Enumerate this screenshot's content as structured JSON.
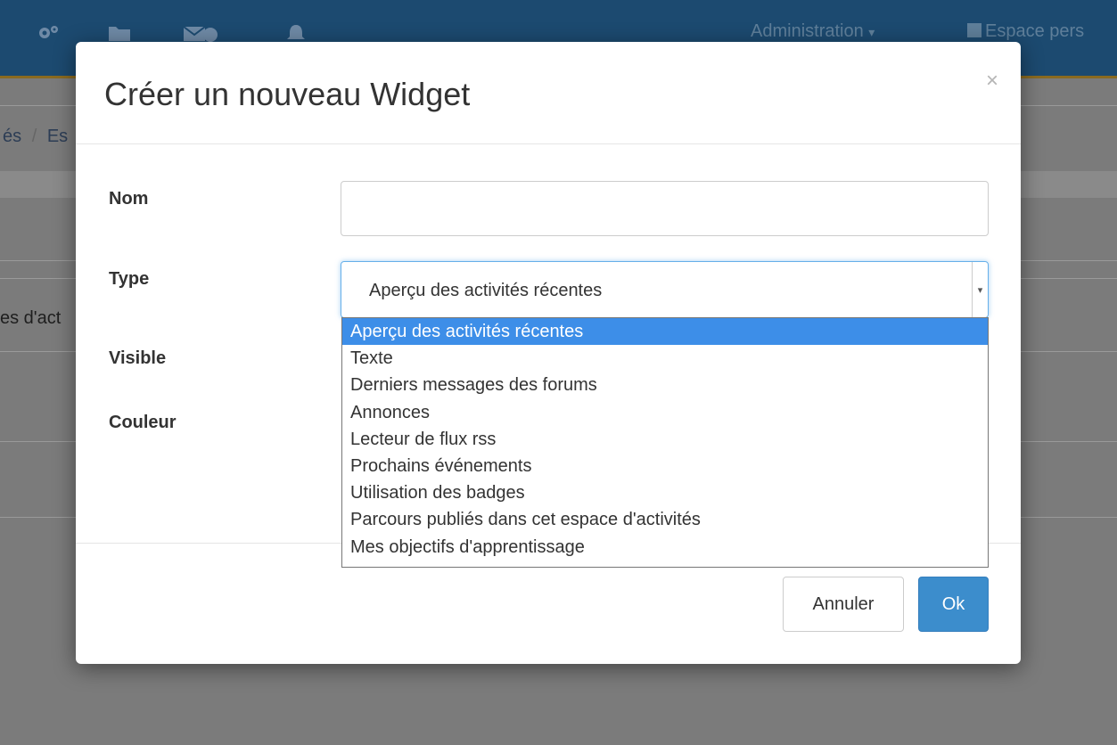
{
  "topbar": {
    "icons": [
      "cogs-icon",
      "folder-icon",
      "envelope-icon",
      "bell-icon"
    ],
    "admin_label": "Administration",
    "admin_caret": "▾",
    "personal_label": "Espace pers"
  },
  "background": {
    "breadcrumb_left": "és",
    "breadcrumb_sep": "/",
    "breadcrumb_right": "Es",
    "partial_text": "es d'act"
  },
  "modal": {
    "title": "Créer un nouveau Widget",
    "close_label": "×",
    "fields": {
      "name_label": "Nom",
      "name_value": "",
      "type_label": "Type",
      "type_selected": "Aperçu des activités récentes",
      "visible_label": "Visible",
      "color_label": "Couleur"
    },
    "type_options": [
      "Aperçu des activités récentes",
      "Texte",
      "Derniers messages des forums",
      "Annonces",
      "Lecteur de flux rss",
      "Prochains événements",
      "Utilisation des badges",
      "Parcours publiés dans cet espace d'activités",
      "Mes objectifs d'apprentissage"
    ],
    "selected_index": 0,
    "cancel_label": "Annuler",
    "ok_label": "Ok"
  },
  "colors": {
    "topbar": "#1c4a70",
    "overlay": "#7b7b7b",
    "primary": "#3c8dcc",
    "option_highlight": "#3d8ee8"
  }
}
